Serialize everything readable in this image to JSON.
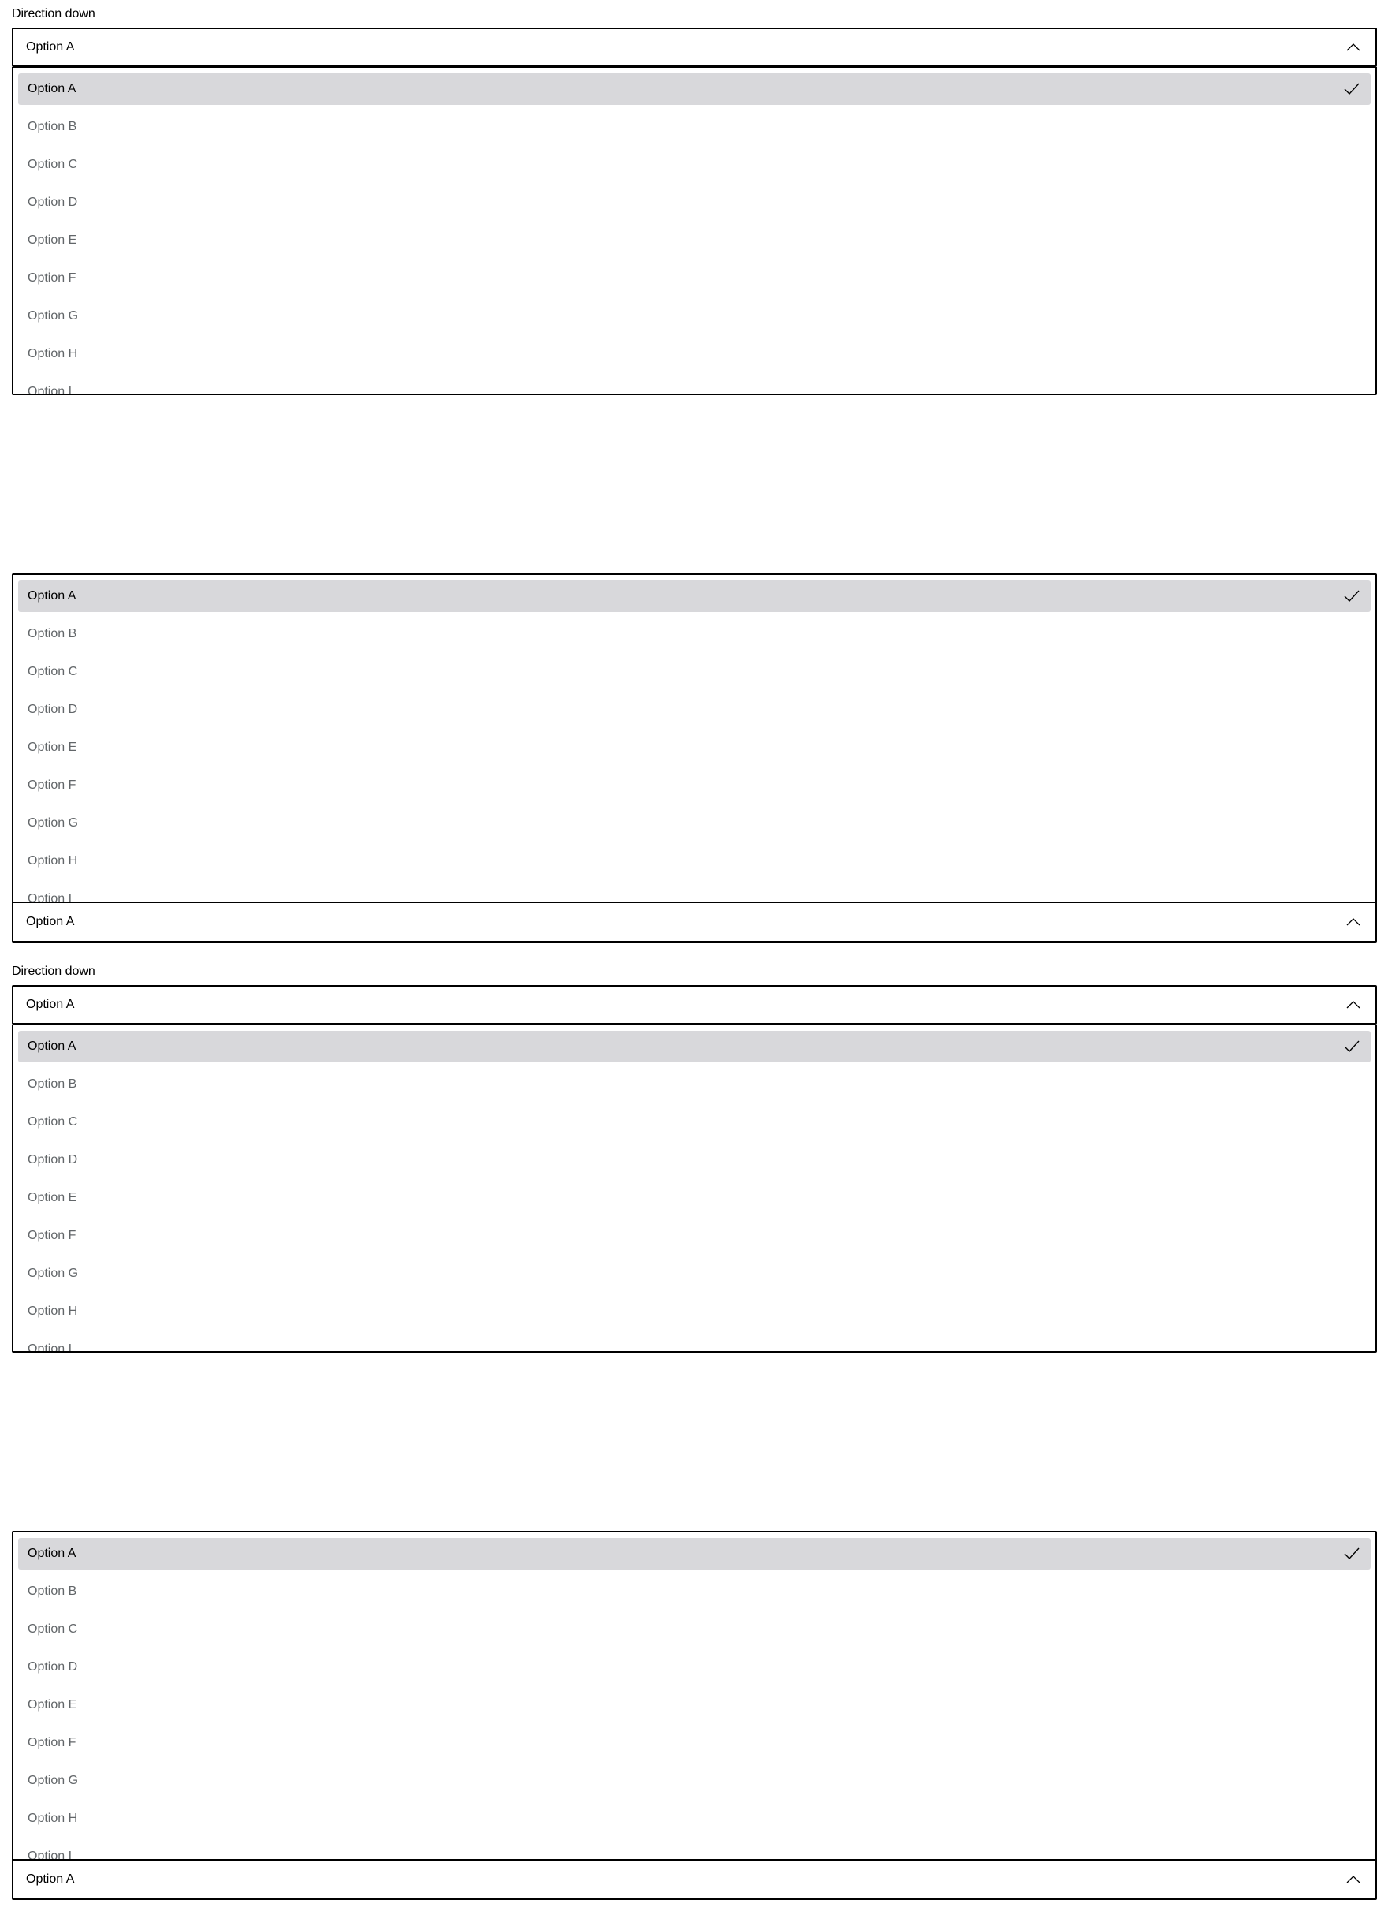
{
  "icons": {
    "chevron": "chevron-up-icon",
    "check": "checkmark-icon"
  },
  "colors": {
    "border": "#000000",
    "selected_background": "#d8d8db",
    "option_text": "#626669",
    "selected_text": "#000000"
  },
  "demos": [
    {
      "label": "Direction down",
      "direction": "down",
      "value": "Option A",
      "options": [
        "Option A",
        "Option B",
        "Option C",
        "Option D",
        "Option E",
        "Option F",
        "Option G",
        "Option H",
        "Option I"
      ],
      "selected_option": "Option A"
    },
    {
      "label": "",
      "direction": "up",
      "value": "Option A",
      "options": [
        "Option A",
        "Option B",
        "Option C",
        "Option D",
        "Option E",
        "Option F",
        "Option G",
        "Option H",
        "Option I"
      ],
      "selected_option": "Option A"
    },
    {
      "label": "Direction down",
      "direction": "down",
      "value": "Option A",
      "options": [
        "Option A",
        "Option B",
        "Option C",
        "Option D",
        "Option E",
        "Option F",
        "Option G",
        "Option H",
        "Option I"
      ],
      "selected_option": "Option A"
    },
    {
      "label": "",
      "direction": "up",
      "value": "Option A",
      "options": [
        "Option A",
        "Option B",
        "Option C",
        "Option D",
        "Option E",
        "Option F",
        "Option G",
        "Option H",
        "Option I"
      ],
      "selected_option": "Option A"
    }
  ]
}
